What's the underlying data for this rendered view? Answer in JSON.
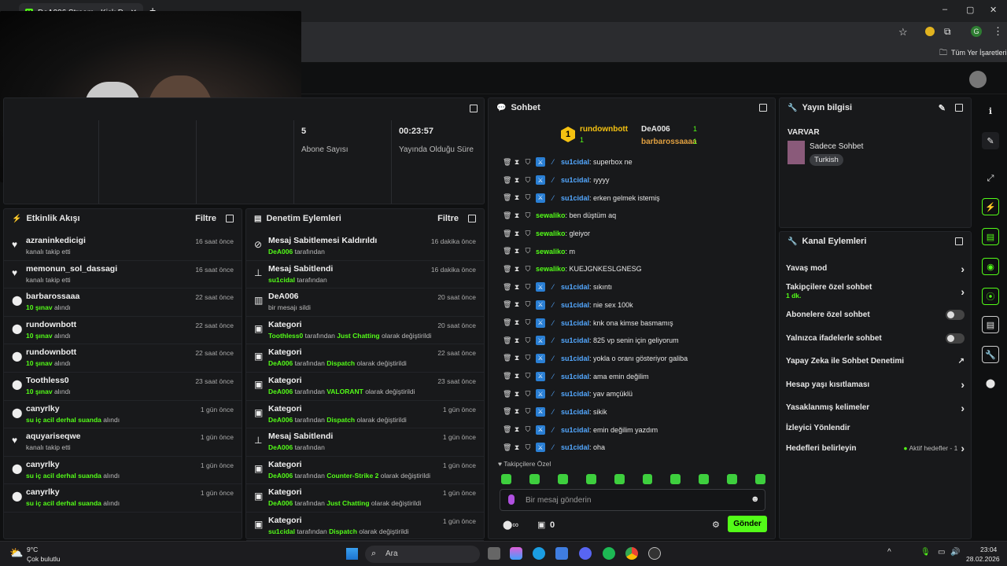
{
  "browser": {
    "tab_title": "DeA006 Stream - Kick Dashboa",
    "bookmarks_label": "Tüm Yer İşaretleri",
    "profile_letter": "G"
  },
  "stats": {
    "subs_value": "5",
    "subs_label": "Abone Sayısı",
    "uptime_value": "00:23:57",
    "uptime_label": "Yayında Olduğu Süre"
  },
  "activity": {
    "title": "Etkinlik Akışı",
    "filter": "Filtre",
    "items": [
      {
        "icon": "♥",
        "name": "azraninkedicigi",
        "sub": "kanalı takip etti",
        "hl": "",
        "time": "16 saat önce"
      },
      {
        "icon": "♥",
        "name": "memonun_sol_dassagi",
        "sub": "kanalı takip etti",
        "hl": "",
        "time": "16 saat önce"
      },
      {
        "icon": "⬤",
        "name": "barbarossaaa",
        "sub": "alındı",
        "hl": "10 şınav",
        "time": "22 saat önce"
      },
      {
        "icon": "⬤",
        "name": "rundownbott",
        "sub": "alındı",
        "hl": "10 şınav",
        "time": "22 saat önce"
      },
      {
        "icon": "⬤",
        "name": "rundownbott",
        "sub": "alındı",
        "hl": "10 şınav",
        "time": "22 saat önce"
      },
      {
        "icon": "⬤",
        "name": "Toothless0",
        "sub": "alındı",
        "hl": "10 şınav",
        "time": "23 saat önce"
      },
      {
        "icon": "⬤",
        "name": "canyrlky",
        "sub": "alındı",
        "hl": "su iç acil derhal suanda",
        "time": "1 gün önce"
      },
      {
        "icon": "♥",
        "name": "aquyariseqwe",
        "sub": "kanalı takip etti",
        "hl": "",
        "time": "1 gün önce"
      },
      {
        "icon": "⬤",
        "name": "canyrlky",
        "sub": "alındı",
        "hl": "su iç acil derhal suanda",
        "time": "1 gün önce"
      },
      {
        "icon": "⬤",
        "name": "canyrlky",
        "sub": "alındı",
        "hl": "su iç acil derhal suanda",
        "time": "1 gün önce"
      }
    ]
  },
  "moderation": {
    "title": "Denetim Eylemleri",
    "filter": "Filtre",
    "items": [
      {
        "icon": "⊘",
        "title": "Mesaj Sabitlemesi Kaldırıldı",
        "who": "DeA006",
        "mid": "tarafından",
        "cat": "",
        "end": "",
        "time": "16 dakika önce"
      },
      {
        "icon": "⊥",
        "title": "Mesaj Sabitlendi",
        "who": "su1cidal",
        "mid": "tarafından",
        "cat": "",
        "end": "",
        "time": "16 dakika önce"
      },
      {
        "icon": "▥",
        "title": "DeA006",
        "who": "",
        "mid": "bir mesajı sildi",
        "cat": "",
        "end": "",
        "time": "20 saat önce"
      },
      {
        "icon": "▣",
        "title": "Kategori",
        "who": "Toothless0",
        "mid": "tarafından",
        "cat": "Just Chatting",
        "end": "olarak değiştirildi",
        "time": "20 saat önce"
      },
      {
        "icon": "▣",
        "title": "Kategori",
        "who": "DeA006",
        "mid": "tarafından",
        "cat": "Dispatch",
        "end": "olarak değiştirildi",
        "time": "22 saat önce"
      },
      {
        "icon": "▣",
        "title": "Kategori",
        "who": "DeA006",
        "mid": "tarafından",
        "cat": "VALORANT",
        "end": "olarak değiştirildi",
        "time": "23 saat önce"
      },
      {
        "icon": "▣",
        "title": "Kategori",
        "who": "DeA006",
        "mid": "tarafından",
        "cat": "Dispatch",
        "end": "olarak değiştirildi",
        "time": "1 gün önce"
      },
      {
        "icon": "⊥",
        "title": "Mesaj Sabitlendi",
        "who": "DeA006",
        "mid": "tarafından",
        "cat": "",
        "end": "",
        "time": "1 gün önce"
      },
      {
        "icon": "▣",
        "title": "Kategori",
        "who": "DeA006",
        "mid": "tarafından",
        "cat": "Counter-Strike 2",
        "end": "olarak değiştirildi",
        "time": "1 gün önce"
      },
      {
        "icon": "▣",
        "title": "Kategori",
        "who": "DeA006",
        "mid": "tarafından",
        "cat": "Just Chatting",
        "end": "olarak değiştirildi",
        "time": "1 gün önce"
      },
      {
        "icon": "▣",
        "title": "Kategori",
        "who": "su1cidal",
        "mid": "tarafından",
        "cat": "Dispatch",
        "end": "olarak değiştirildi",
        "time": "1 gün önce"
      }
    ]
  },
  "chat": {
    "title": "Sohbet",
    "leaders": {
      "first_rank": "1",
      "first_name": "rundownbott",
      "first_count": "1",
      "second_name": "DeA006",
      "second_count": "1",
      "third_name": "barbarossaaaa",
      "third_count": "1"
    },
    "messages": [
      {
        "user": "su1cidal",
        "text": "superbox ne",
        "badge": true,
        "color": "#53a8ff"
      },
      {
        "user": "su1cidal",
        "text": "ıyyyy",
        "badge": true,
        "color": "#53a8ff"
      },
      {
        "user": "su1cidal",
        "text": "erken gelmek istemiş",
        "badge": true,
        "color": "#53a8ff"
      },
      {
        "user": "sewaliko",
        "text": "ben düştüm aq",
        "badge": false,
        "color": "#53fc18"
      },
      {
        "user": "sewaliko",
        "text": "gleiyor",
        "badge": false,
        "color": "#53fc18"
      },
      {
        "user": "sewaliko",
        "text": "m",
        "badge": false,
        "color": "#53fc18"
      },
      {
        "user": "sewaliko",
        "text": "KUEJGNKESLGNESG",
        "badge": false,
        "color": "#53fc18"
      },
      {
        "user": "su1cidal",
        "text": "sıkıntı",
        "badge": true,
        "color": "#53a8ff"
      },
      {
        "user": "su1cidal",
        "text": "nie sex 100k",
        "badge": true,
        "color": "#53a8ff"
      },
      {
        "user": "su1cidal",
        "text": "knk ona kimse basmamış",
        "badge": true,
        "color": "#53a8ff"
      },
      {
        "user": "su1cidal",
        "text": "825 vp senin için geliyorum",
        "badge": true,
        "color": "#53a8ff"
      },
      {
        "user": "su1cidal",
        "text": "yokla o oranı gösteriyor galiba",
        "badge": true,
        "color": "#53a8ff"
      },
      {
        "user": "su1cidal",
        "text": "ama emin değilim",
        "badge": true,
        "color": "#53a8ff"
      },
      {
        "user": "su1cidal",
        "text": "yav amçüklü",
        "badge": true,
        "color": "#53a8ff"
      },
      {
        "user": "su1cidal",
        "text": "sikik",
        "badge": true,
        "color": "#53a8ff"
      },
      {
        "user": "su1cidal",
        "text": "emin değilim yazdım",
        "badge": true,
        "color": "#53a8ff"
      },
      {
        "user": "su1cidal",
        "text": "oha",
        "badge": true,
        "color": "#53a8ff"
      }
    ],
    "emote_section": "Takipçilere Özel",
    "input_placeholder": "Bir mesaj gönderin",
    "points": "0",
    "send": "Gönder"
  },
  "stream_info": {
    "title": "Yayın bilgisi",
    "stream_title": "VARVAR",
    "category": "Sadece Sohbet",
    "tag": "Turkish"
  },
  "channel_actions": {
    "title": "Kanal Eylemleri",
    "slow": "Yavaş mod",
    "followers": "Takipçilere özel sohbet",
    "followers_sub": "1 dk.",
    "subs": "Abonelere özel sohbet",
    "emotes": "Yalnızca ifadelerle sohbet",
    "ai": "Yapay Zeka ile Sohbet Denetimi",
    "age": "Hesap yaşı kısıtlaması",
    "banned": "Yasaklanmış kelimeler",
    "redirect": "İzleyici Yönlendir",
    "goals": "Hedefleri belirleyin",
    "goals_status": "Aktif hedefler - 1"
  },
  "taskbar": {
    "temp": "9°C",
    "weather": "Çok bulutlu",
    "search": "Ara",
    "time": "23:04",
    "date": "28.02.2026"
  }
}
